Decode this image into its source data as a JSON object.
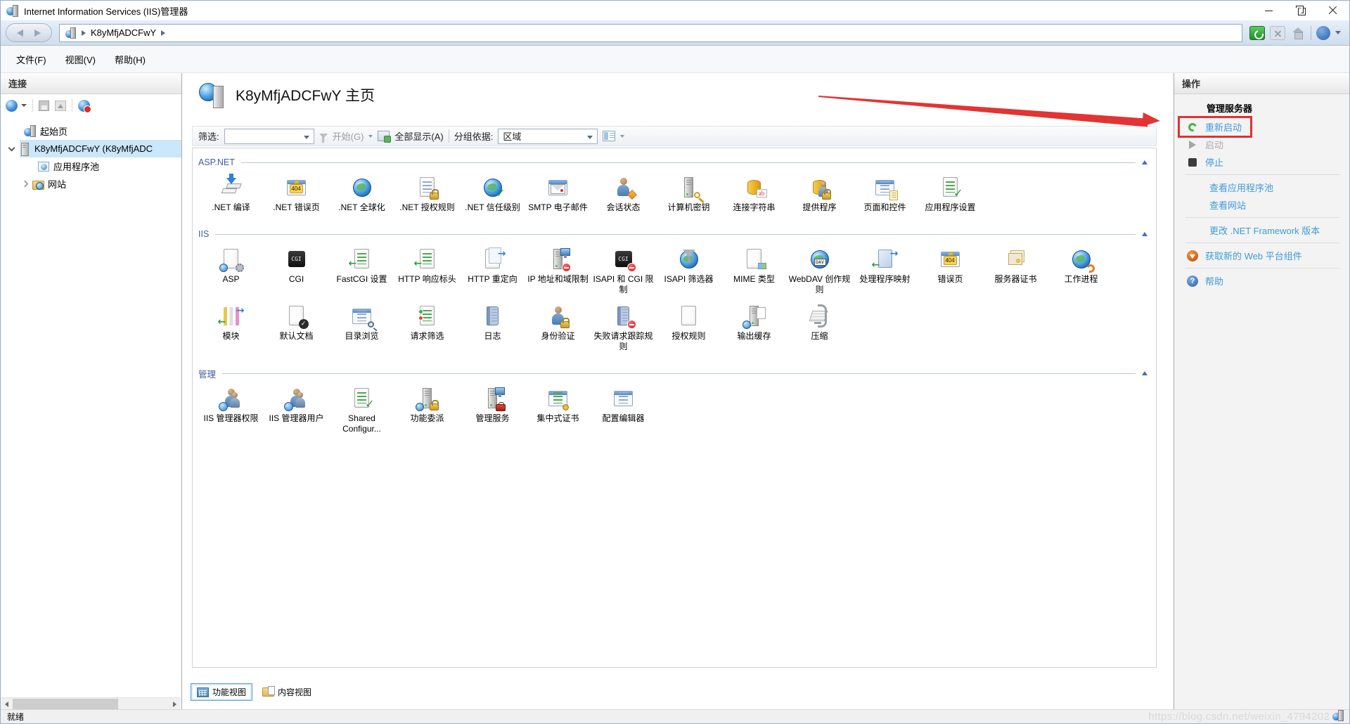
{
  "window": {
    "title": "Internet Information Services (IIS)管理器"
  },
  "address_bar": {
    "path": "K8yMfjADCFwY"
  },
  "menu": {
    "items": [
      {
        "label": "文件(F)"
      },
      {
        "label": "视图(V)"
      },
      {
        "label": "帮助(H)"
      }
    ]
  },
  "connections": {
    "title": "连接",
    "tree": [
      {
        "label": "起始页",
        "icon": "start-page-icon",
        "selected": false
      },
      {
        "label": "K8yMfjADCFwY (K8yMfjADC",
        "icon": "server-icon",
        "selected": true
      },
      {
        "label": "应用程序池",
        "icon": "app-pools-icon",
        "selected": false
      },
      {
        "label": "网站",
        "icon": "sites-icon",
        "selected": false
      }
    ]
  },
  "main": {
    "page_title": "K8yMfjADCFwY 主页",
    "toolbar": {
      "filter_label": "筛选:",
      "filter_value": "",
      "go_label": "开始(G)",
      "show_all_label": "全部显示(A)",
      "group_by_label": "分组依据:",
      "group_by_value": "区域"
    },
    "sections": [
      {
        "title": "ASP.NET",
        "items": [
          {
            "label": ".NET 编译",
            "icon": "net-compilation"
          },
          {
            "label": ".NET 错误页",
            "icon": "net-error-pages"
          },
          {
            "label": ".NET 全球化",
            "icon": "net-globalization"
          },
          {
            "label": ".NET 授权规则",
            "icon": "net-authorization-rules"
          },
          {
            "label": ".NET 信任级别",
            "icon": "net-trust-levels"
          },
          {
            "label": "SMTP 电子邮件",
            "icon": "smtp-email"
          },
          {
            "label": "会话状态",
            "icon": "session-state"
          },
          {
            "label": "计算机密钥",
            "icon": "machine-key"
          },
          {
            "label": "连接字符串",
            "icon": "connection-strings"
          },
          {
            "label": "提供程序",
            "icon": "providers"
          },
          {
            "label": "页面和控件",
            "icon": "pages-and-controls"
          },
          {
            "label": "应用程序设置",
            "icon": "application-settings"
          }
        ]
      },
      {
        "title": "IIS",
        "items": [
          {
            "label": "ASP",
            "icon": "asp"
          },
          {
            "label": "CGI",
            "icon": "cgi"
          },
          {
            "label": "FastCGI 设置",
            "icon": "fastcgi-settings"
          },
          {
            "label": "HTTP 响应标头",
            "icon": "http-response-headers"
          },
          {
            "label": "HTTP 重定向",
            "icon": "http-redirect"
          },
          {
            "label": "IP 地址和域限制",
            "icon": "ip-domain-restrictions"
          },
          {
            "label": "ISAPI 和 CGI 限制",
            "icon": "isapi-cgi-restrictions"
          },
          {
            "label": "ISAPI 筛选器",
            "icon": "isapi-filters"
          },
          {
            "label": "MIME 类型",
            "icon": "mime-types"
          },
          {
            "label": "WebDAV 创作规则",
            "icon": "webdav-authoring-rules"
          },
          {
            "label": "处理程序映射",
            "icon": "handler-mappings"
          },
          {
            "label": "错误页",
            "icon": "error-pages"
          },
          {
            "label": "服务器证书",
            "icon": "server-certificates"
          },
          {
            "label": "工作进程",
            "icon": "worker-processes"
          },
          {
            "label": "模块",
            "icon": "modules"
          },
          {
            "label": "默认文档",
            "icon": "default-document"
          },
          {
            "label": "目录浏览",
            "icon": "directory-browsing"
          },
          {
            "label": "请求筛选",
            "icon": "request-filtering"
          },
          {
            "label": "日志",
            "icon": "logging"
          },
          {
            "label": "身份验证",
            "icon": "authentication"
          },
          {
            "label": "失败请求跟踪规则",
            "icon": "failed-request-tracing"
          },
          {
            "label": "授权规则",
            "icon": "authorization-rules"
          },
          {
            "label": "输出缓存",
            "icon": "output-caching"
          },
          {
            "label": "压缩",
            "icon": "compression"
          }
        ]
      },
      {
        "title": "管理",
        "items": [
          {
            "label": "IIS 管理器权限",
            "icon": "iis-manager-permissions"
          },
          {
            "label": "IIS 管理器用户",
            "icon": "iis-manager-users"
          },
          {
            "label": "Shared Configur...",
            "icon": "shared-configuration"
          },
          {
            "label": "功能委派",
            "icon": "feature-delegation"
          },
          {
            "label": "管理服务",
            "icon": "management-service"
          },
          {
            "label": "集中式证书",
            "icon": "centralized-certificates"
          },
          {
            "label": "配置编辑器",
            "icon": "configuration-editor"
          }
        ]
      }
    ],
    "tabs": [
      {
        "label": "功能视图",
        "selected": true
      },
      {
        "label": "内容视图",
        "selected": false
      }
    ]
  },
  "actions": {
    "title": "操作",
    "group_title": "管理服务器",
    "items": [
      {
        "name": "restart-server",
        "label": "重新启动",
        "icon": "restart-icon",
        "disabled": false,
        "highlighted": true
      },
      {
        "name": "start-server",
        "label": "启动",
        "icon": "start-icon",
        "disabled": true
      },
      {
        "name": "stop-server",
        "label": "停止",
        "icon": "stop-icon",
        "disabled": false
      },
      {
        "divider": true
      },
      {
        "name": "view-application-pools",
        "label": "查看应用程序池",
        "disabled": false
      },
      {
        "name": "view-sites",
        "label": "查看网站",
        "disabled": false
      },
      {
        "divider": true
      },
      {
        "name": "change-net-framework-version",
        "label": "更改 .NET Framework 版本",
        "disabled": false
      },
      {
        "divider": true
      },
      {
        "name": "get-new-web-platform-components",
        "label": "获取新的 Web 平台组件",
        "icon": "download-icon",
        "disabled": false
      },
      {
        "divider": true
      },
      {
        "name": "help",
        "label": "帮助",
        "icon": "help-icon",
        "disabled": false
      }
    ]
  },
  "status_bar": {
    "text": "就绪"
  },
  "watermark": {
    "text": "https://blog.csdn.net/weixin_4794202"
  },
  "colors": {
    "accent_link": "#3f9bd8",
    "section_title": "#3e5f9e",
    "annotation": "#e23434",
    "selection": "#cbe7fa"
  }
}
